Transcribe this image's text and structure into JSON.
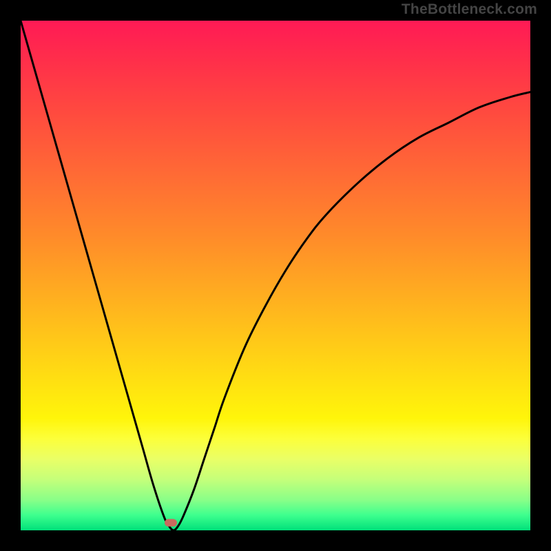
{
  "watermark": "TheBottleneck.com",
  "chart_data": {
    "type": "line",
    "title": "",
    "xlabel": "",
    "ylabel": "",
    "xlim": [
      0,
      100
    ],
    "ylim": [
      0,
      100
    ],
    "grid": false,
    "legend": false,
    "series": [
      {
        "name": "curve",
        "x": [
          0,
          2,
          4,
          6,
          8,
          10,
          12,
          14,
          16,
          18,
          20,
          22,
          24,
          26,
          28,
          29,
          30,
          31,
          32,
          34,
          36,
          38,
          40,
          44,
          48,
          52,
          56,
          60,
          66,
          72,
          78,
          84,
          90,
          96,
          100
        ],
        "y": [
          100,
          93,
          86,
          79,
          72,
          65,
          58,
          51,
          44,
          37,
          30,
          23,
          16,
          9,
          3,
          1,
          0,
          1,
          3,
          8,
          14,
          20,
          26,
          36,
          44,
          51,
          57,
          62,
          68,
          73,
          77,
          80,
          83,
          85,
          86
        ]
      }
    ],
    "marker": {
      "x": 29.5,
      "y": 1.5
    },
    "background": {
      "type": "vertical-gradient",
      "stops": [
        {
          "pos": 0,
          "color": "#ff1a55"
        },
        {
          "pos": 50,
          "color": "#ff9a22"
        },
        {
          "pos": 80,
          "color": "#fff50a"
        },
        {
          "pos": 100,
          "color": "#00e07a"
        }
      ]
    }
  }
}
